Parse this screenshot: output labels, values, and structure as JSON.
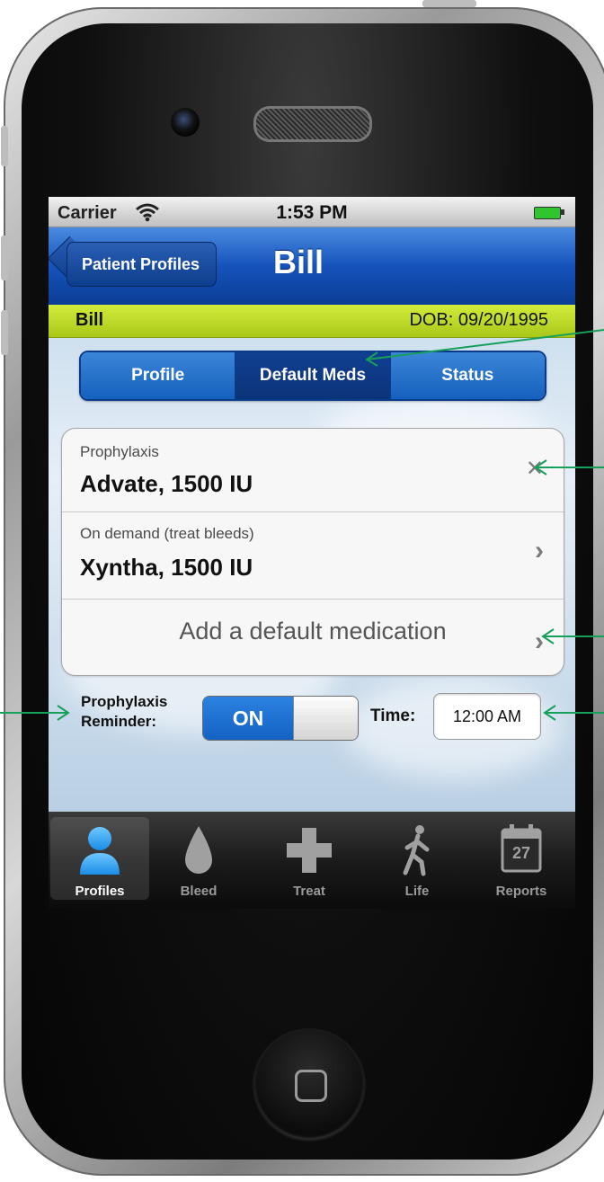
{
  "status_bar": {
    "carrier": "Carrier",
    "time": "1:53 PM"
  },
  "nav": {
    "back_label": "Patient Profiles",
    "title": "Bill"
  },
  "patient": {
    "name": "Bill",
    "dob": "DOB: 09/20/1995"
  },
  "segments": [
    {
      "label": "Profile",
      "selected": false
    },
    {
      "label": "Default Meds",
      "selected": true
    },
    {
      "label": "Status",
      "selected": false
    }
  ],
  "meds": [
    {
      "caption": "Prophylaxis",
      "value": "Advate, 1500 IU",
      "chevron": "✕"
    },
    {
      "caption": "On demand (treat bleeds)",
      "value": "Xyntha, 1500 IU",
      "chevron": "›"
    }
  ],
  "add_medication": {
    "label": "Add a default medication",
    "chevron": "›"
  },
  "reminder": {
    "label_line1": "Prophylaxis",
    "label_line2": "Reminder:",
    "switch_label": "ON",
    "time_label": "Time:",
    "time_value": "12:00 AM"
  },
  "tab_bar": {
    "items": [
      {
        "label": "Profiles",
        "icon": "person-icon",
        "selected": true
      },
      {
        "label": "Bleed",
        "icon": "drop-icon",
        "selected": false
      },
      {
        "label": "Treat",
        "icon": "plus-icon",
        "selected": false
      },
      {
        "label": "Life",
        "icon": "walking-person-icon",
        "selected": false
      },
      {
        "label": "Reports",
        "icon": "calendar-icon",
        "selected": false,
        "calendar_day": "27"
      }
    ]
  },
  "colors": {
    "nav_blue": "#1553bb",
    "patient_bar_green": "#c2dc2a",
    "annotation_green": "#16a05a"
  }
}
